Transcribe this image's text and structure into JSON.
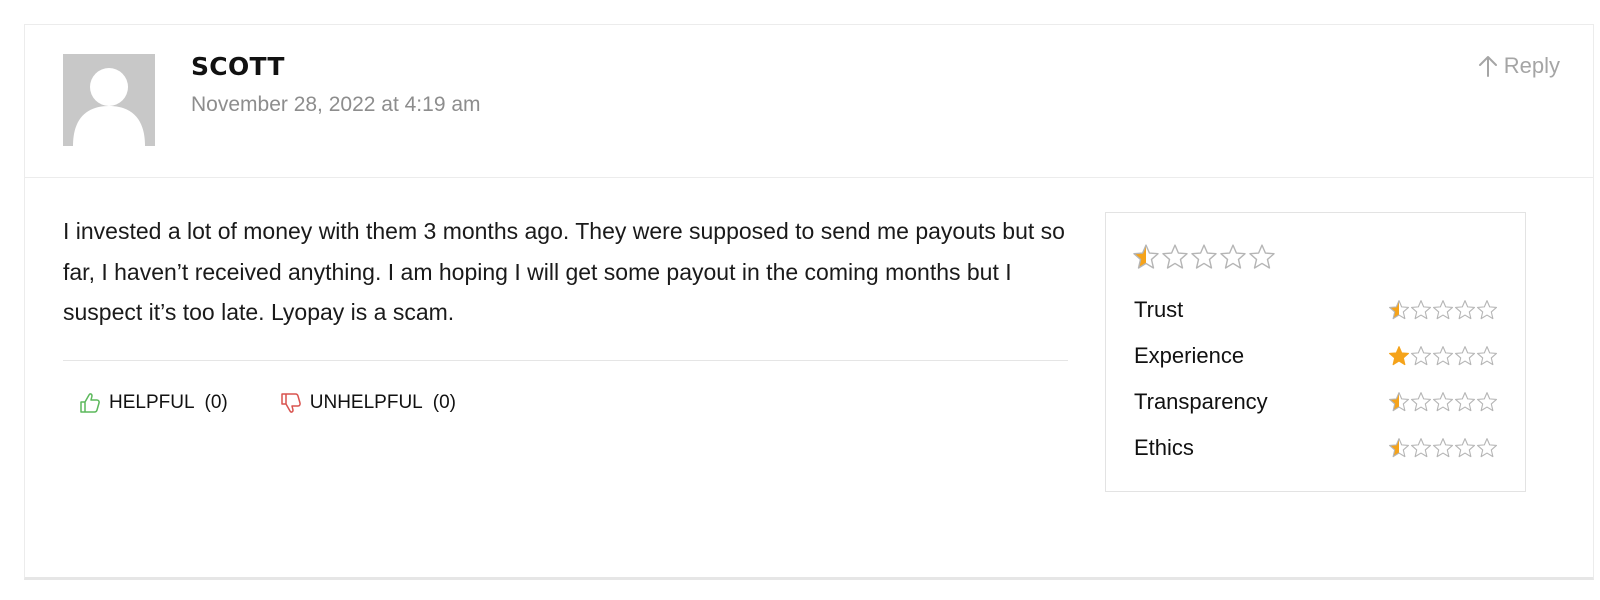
{
  "comment": {
    "author": "SCOTT",
    "date": "November 28, 2022 at 4:19 am",
    "reply_label": "Reply",
    "text": "I invested a lot of money with them 3 months ago. They were supposed to send me payouts but so far, I haven’t received anything. I am hoping I will get some payout in the coming months but I suspect it’s too late. Lyopay is a scam.",
    "avatar_icon": "default-user-avatar-icon"
  },
  "votes": {
    "helpful_label": "HELPFUL",
    "helpful_count": "(0)",
    "unhelpful_label": "UNHELPFUL",
    "unhelpful_count": "(0)",
    "helpful_icon": "thumbs-up-icon",
    "unhelpful_icon": "thumbs-down-icon"
  },
  "ratings": {
    "max_stars": 5,
    "overall": 0.5,
    "items": [
      {
        "label": "Trust",
        "value": 0.5
      },
      {
        "label": "Experience",
        "value": 1
      },
      {
        "label": "Transparency",
        "value": 0.5
      },
      {
        "label": "Ethics",
        "value": 0.5
      }
    ]
  },
  "colors": {
    "star_fill": "#f5a31a",
    "star_empty": "#b5b5b5",
    "helpful_icon": "#5cb85c",
    "unhelpful_icon": "#d9534f",
    "muted_text": "#8d8d8d",
    "avatar_bg": "#c8c8c8"
  }
}
